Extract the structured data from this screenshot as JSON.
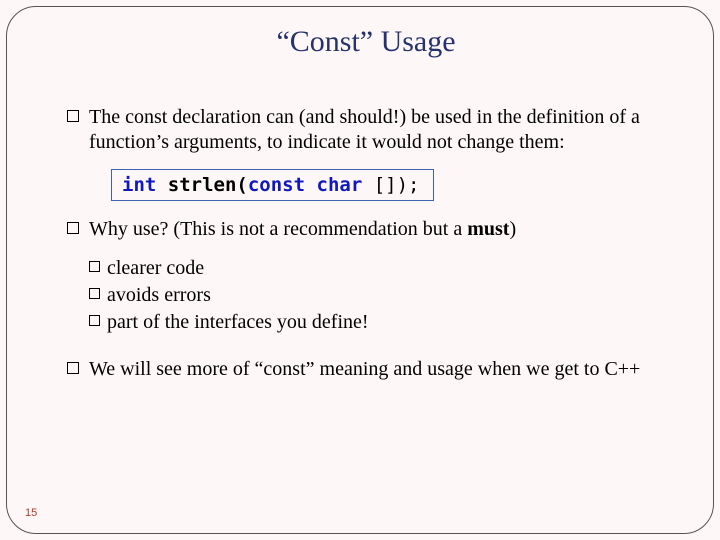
{
  "title": "“Const” Usage",
  "bullets": {
    "b1": "The const declaration can (and should!) be used in the definition of a function’s arguments, to indicate it would not change them:",
    "b2_pre": "Why use? (This is not a recommendation but a ",
    "b2_bold": "must",
    "b2_post": ")",
    "b2a": "clearer code",
    "b2b": "avoids errors",
    "b2c": "part of the interfaces you define!",
    "b3": "We will see more of “const” meaning and usage when we get to C++"
  },
  "code": {
    "kw1": "int",
    "fn": " strlen(",
    "kw2": "const",
    "mid": " ",
    "kw3": "char",
    "tail": " []);"
  },
  "page_number": "15"
}
